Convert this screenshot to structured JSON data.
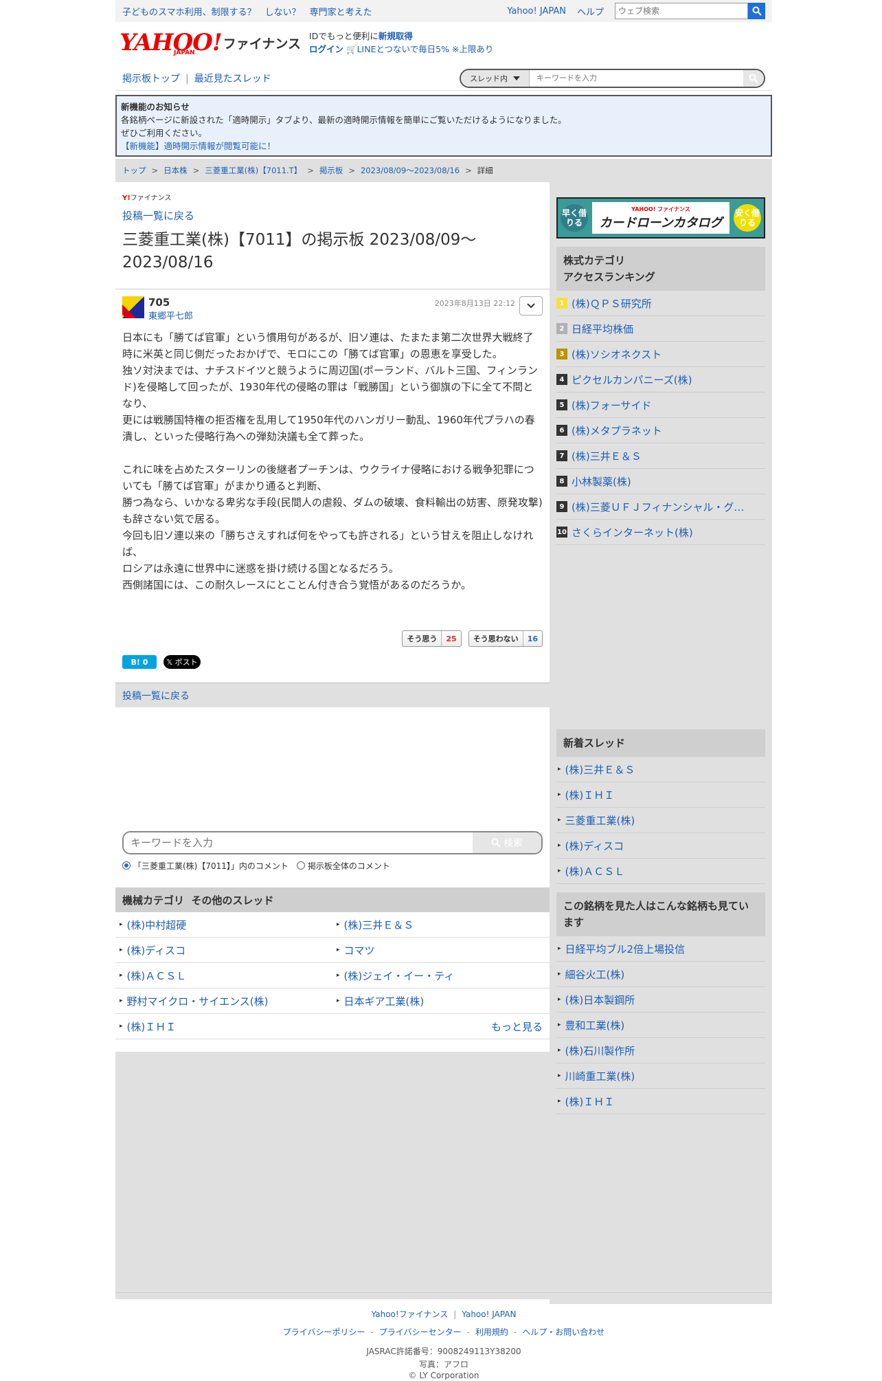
{
  "topbar": {
    "promo": "子どものスマホ利用、制限する？　しない？　専門家と考えた",
    "yahoo_japan": "Yahoo! JAPAN",
    "help": "ヘルプ",
    "web_search_placeholder": "ウェブ検索"
  },
  "header": {
    "logo_text": "YAHOO!",
    "logo_sub": "JAPAN",
    "logo_finance": "ファイナンス",
    "id_text": "IDでもっと便利に",
    "signup": "新規取得",
    "login": "ログイン",
    "line_promo": "LINEとつないで毎日5% ※上限あり"
  },
  "nav": {
    "board_top": "掲示板トップ",
    "recent": "最近見たスレッド",
    "scope": "スレッド内",
    "keyword_placeholder": "キーワードを入力"
  },
  "notice": {
    "title": "新機能のお知らせ",
    "line1": "各銘柄ページに新設された「適時開示」タブより、最新の適時開示情報を簡単にご覧いただけるようになりました。",
    "line2": "ぜひご利用ください。",
    "link": "【新機能】適時開示情報が閲覧可能に！"
  },
  "breadcrumb": {
    "items": [
      "トップ",
      "日本株",
      "三菱重工業(株)【7011.T】",
      "掲示板",
      "2023/08/09〜2023/08/16"
    ],
    "current": "詳細",
    "sep": ">"
  },
  "main": {
    "small_logo": "Y!",
    "small_logo_text": "ファイナンス",
    "back_link": "投稿一覧に戻る",
    "title": "三菱重工業(株)【7011】の掲示板 2023/08/09〜2023/08/16",
    "post": {
      "number": "705",
      "user": "東郷平七郎",
      "date": "2023年8月13日 22:12",
      "body": "日本にも「勝てば官軍」という慣用句があるが、旧ソ連は、たまたま第二次世界大戦終了時に米英と同じ側だったおかげで、モロにこの「勝てば官軍」の恩恵を享受した。\n独ソ対決までは、ナチスドイツと競うように周辺国(ポーランド、バルト三国、フィンランド)を侵略して回ったが、1930年代の侵略の罪は「戦勝国」という御旗の下に全て不問となり、\n更には戦勝国特権の拒否権を乱用して1950年代のハンガリー動乱、1960年代プラハの春潰し、といった侵略行為への弾劾決議も全て葬った。\n\nこれに味を占めたスターリンの後継者プーチンは、ウクライナ侵略における戦争犯罪についても「勝てば官軍」がまかり通ると判断、\n勝つ為なら、いかなる卑劣な手段(民間人の虐殺、ダムの破壊、食料輸出の妨害、原発攻撃)も辞さない気で居る。\n今回も旧ソ連以来の「勝ちさえすれば何をやっても許される」という甘えを阻止しなければ、\nロシアは永遠に世界中に迷惑を掛け続ける国となるだろう。\n西側諸国には、この耐久レースにとことん付き合う覚悟があるのだろうか。",
      "agree_label": "そう思う",
      "agree_count": "25",
      "disagree_label": "そう思わない",
      "disagree_count": "16",
      "hatena": "B! 0",
      "x_post": "𝕏 ポスト"
    },
    "back_link2": "投稿一覧に戻る",
    "search_placeholder": "キーワードを入力",
    "search_button": "検索",
    "radio_thread": "「三菱重工業(株)【7011】」内のコメント",
    "radio_all": "掲示板全体のコメント",
    "others_title": "機械カテゴリ  その他のスレッド",
    "others": [
      "(株)中村超硬",
      "(株)三井Ｅ＆Ｓ",
      "(株)ディスコ",
      "コマツ",
      "(株)ＡＣＳＬ",
      "(株)ジェイ・イー・ティ",
      "野村マイクロ・サイエンス(株)",
      "日本ギア工業(株)",
      "(株)ＩＨＩ"
    ],
    "more": "もっと見る"
  },
  "side": {
    "banner_left": "早く借りる",
    "banner_right": "安く借りる",
    "banner_brand": "YAHOO! ファイナンス",
    "banner_title": "カードローンカタログ",
    "ranking_title_1": "株式カテゴリ",
    "ranking_title_2": "アクセスランキング",
    "ranking": [
      {
        "rank": "1",
        "name": "(株)ＱＰＳ研究所"
      },
      {
        "rank": "2",
        "name": "日経平均株価"
      },
      {
        "rank": "3",
        "name": "(株)ソシオネクスト"
      },
      {
        "rank": "4",
        "name": "ピクセルカンパニーズ(株)"
      },
      {
        "rank": "5",
        "name": "(株)フォーサイド"
      },
      {
        "rank": "6",
        "name": "(株)メタプラネット"
      },
      {
        "rank": "7",
        "name": "(株)三井Ｅ＆Ｓ"
      },
      {
        "rank": "8",
        "name": "小林製薬(株)"
      },
      {
        "rank": "9",
        "name": "(株)三菱ＵＦＪフィナンシャル・グ…"
      },
      {
        "rank": "10",
        "name": "さくらインターネット(株)"
      }
    ],
    "new_threads_title": "新着スレッド",
    "new_threads": [
      "(株)三井Ｅ＆Ｓ",
      "(株)ＩＨＩ",
      "三菱重工業(株)",
      "(株)ディスコ",
      "(株)ＡＣＳＬ"
    ],
    "also_viewed_title": "この銘柄を見た人はこんな銘柄も見ています",
    "also_viewed": [
      "日経平均ブル2倍上場投信",
      "細谷火工(株)",
      "(株)日本製鋼所",
      "豊和工業(株)",
      "(株)石川製作所",
      "川崎重工業(株)",
      "(株)ＩＨＩ"
    ]
  },
  "footer": {
    "links1": [
      "Yahoo!ファイナンス",
      "Yahoo! JAPAN"
    ],
    "links2": [
      "プライバシーポリシー",
      "プライバシーセンター",
      "利用規約",
      "ヘルプ・お問い合わせ"
    ],
    "jasrac": "JASRAC許諾番号：9008249113Y38200",
    "photo": "写真：アフロ",
    "copyright": "© LY Corporation"
  },
  "colors": {
    "link": "#1d5fb6",
    "brand_red": "#ee0000",
    "search_blue": "#1e6fd9"
  }
}
